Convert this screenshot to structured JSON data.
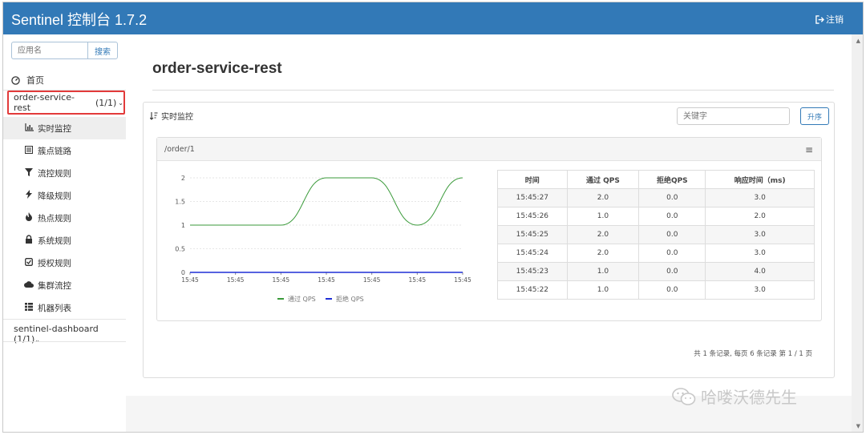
{
  "header": {
    "brand": "Sentinel 控制台 1.7.2",
    "logout": "注销"
  },
  "sidebar": {
    "search_placeholder": "应用名",
    "search_button": "搜索",
    "home": "首页",
    "app": {
      "name": "order-service-rest",
      "count": "(1/1)"
    },
    "items": [
      {
        "label": "实时监控",
        "icon": "bar-chart-icon"
      },
      {
        "label": "簇点链路",
        "icon": "list-icon"
      },
      {
        "label": "流控规则",
        "icon": "filter-icon"
      },
      {
        "label": "降级规则",
        "icon": "bolt-icon"
      },
      {
        "label": "热点规则",
        "icon": "fire-icon"
      },
      {
        "label": "系统规则",
        "icon": "lock-icon"
      },
      {
        "label": "授权规则",
        "icon": "check-icon"
      },
      {
        "label": "集群流控",
        "icon": "cloud-icon"
      },
      {
        "label": "机器列表",
        "icon": "th-list-icon"
      }
    ],
    "app2": {
      "name": "sentinel-dashboard",
      "count": "(1/1)"
    }
  },
  "main": {
    "title": "order-service-rest",
    "panel_title": "实时监控",
    "keyword_placeholder": "关键字",
    "sort_button": "升序",
    "resource": "/order/1",
    "table": {
      "headers": [
        "时间",
        "通过 QPS",
        "拒绝QPS",
        "响应时间（ms)"
      ],
      "rows": [
        [
          "15:45:27",
          "2.0",
          "0.0",
          "3.0"
        ],
        [
          "15:45:26",
          "1.0",
          "0.0",
          "2.0"
        ],
        [
          "15:45:25",
          "2.0",
          "0.0",
          "3.0"
        ],
        [
          "15:45:24",
          "2.0",
          "0.0",
          "3.0"
        ],
        [
          "15:45:23",
          "1.0",
          "0.0",
          "4.0"
        ],
        [
          "15:45:22",
          "1.0",
          "0.0",
          "3.0"
        ]
      ]
    },
    "pagination": "共 1 条记录, 每页 6 条记录 第 1 / 1 页"
  },
  "watermark": "哈喽沃德先生",
  "chart_data": {
    "type": "line",
    "x": [
      "15:45",
      "15:45",
      "15:45",
      "15:45",
      "15:45",
      "15:45",
      "15:45"
    ],
    "series": [
      {
        "name": "通过 QPS",
        "color": "#3a9a3a",
        "values": [
          1,
          1,
          1,
          2,
          2,
          1,
          2
        ]
      },
      {
        "name": "拒绝 QPS",
        "color": "#1f2fd6",
        "values": [
          0,
          0,
          0,
          0,
          0,
          0,
          0
        ]
      }
    ],
    "yticks": [
      "0",
      "0.5",
      "1",
      "1.5",
      "2"
    ],
    "ylim": [
      0,
      2
    ],
    "legend_position": "bottom",
    "grid": true
  }
}
